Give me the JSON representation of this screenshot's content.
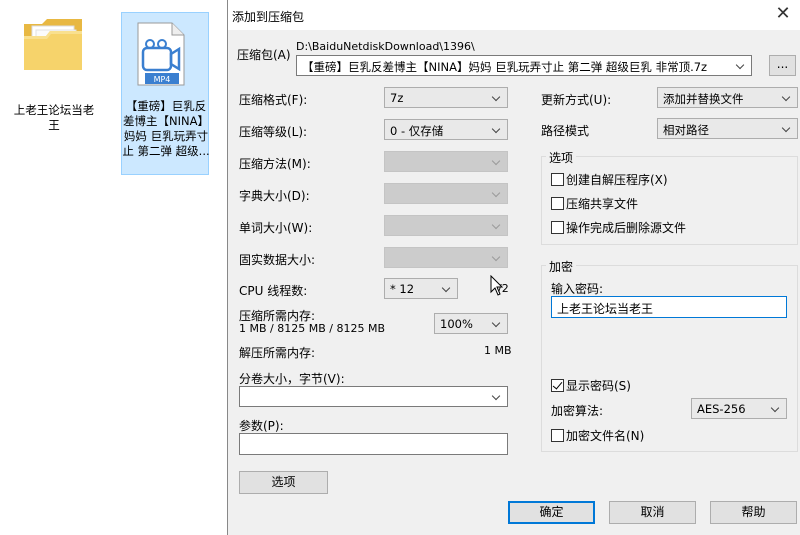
{
  "desktop": {
    "folder": {
      "label": "上老王论坛当老王"
    },
    "video_file": {
      "badge": "MP4",
      "label": "【重磅】巨乳反差博主【NINA】妈妈 巨乳玩弄寸止 第二弹 超级..."
    }
  },
  "dialog": {
    "title": "添加到压缩包",
    "archive_label": "压缩包(A)",
    "archive_path": "D:\\BaiduNetdiskDownload\\1396\\",
    "archive_name": "【重磅】巨乳反差博主【NINA】妈妈 巨乳玩弄寸止 第二弹 超级巨乳 非常顶.7z",
    "browse_label": "...",
    "left": {
      "format_label": "压缩格式(F):",
      "format_value": "7z",
      "level_label": "压缩等级(L):",
      "level_value": "0 - 仅存储",
      "method_label": "压缩方法(M):",
      "dict_label": "字典大小(D):",
      "word_label": "单词大小(W):",
      "solid_label": "固实数据大小:",
      "cpu_label": "CPU 线程数:",
      "cpu_value": "* 12",
      "cpu_max": "/2",
      "mem_comp_label": "压缩所需内存:",
      "mem_comp_value": "1 MB / 8125 MB / 8125 MB",
      "mem_percent": "100%",
      "mem_decomp_label": "解压所需内存:",
      "mem_decomp_value": "1 MB",
      "split_label": "分卷大小，字节(V):",
      "split_value": "",
      "params_label": "参数(P):",
      "params_value": "",
      "options_button": "选项"
    },
    "right": {
      "update_label": "更新方式(U):",
      "update_value": "添加并替换文件",
      "path_label": "路径模式",
      "path_value": "相对路径",
      "options_group": "选项",
      "opt_sfx": "创建自解压程序(X)",
      "opt_shared": "压缩共享文件",
      "opt_delete": "操作完成后删除源文件",
      "encryption_group": "加密",
      "password_label": "输入密码:",
      "password_value": "上老王论坛当老王",
      "show_password": "显示密码(S)",
      "enc_method_label": "加密算法:",
      "enc_method_value": "AES-256",
      "encrypt_names": "加密文件名(N)"
    },
    "buttons": {
      "ok": "确定",
      "cancel": "取消",
      "help": "帮助"
    }
  }
}
